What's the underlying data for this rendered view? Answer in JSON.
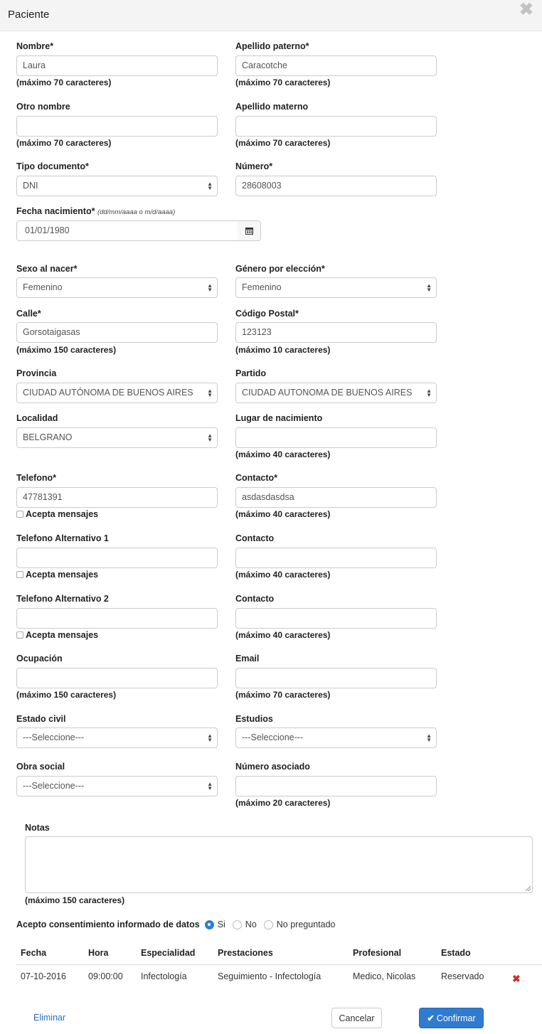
{
  "modal": {
    "title": "Paciente",
    "close_glyph": "✖"
  },
  "labels": {
    "nombre": "Nombre*",
    "apellido_paterno": "Apellido paterno*",
    "otro_nombre": "Otro nombre",
    "apellido_materno": "Apellido materno",
    "tipo_documento": "Tipo documento*",
    "numero": "Número*",
    "fecha_nacimiento": "Fecha nacimiento*",
    "fecha_formato": "(dd/mm/aaaa o m/d/aaaa)",
    "sexo": "Sexo al nacer*",
    "genero": "Género por elección*",
    "calle": "Calle*",
    "codigo_postal": "Código Postal*",
    "provincia": "Provincia",
    "partido": "Partido",
    "localidad": "Localidad",
    "lugar_nacimiento": "Lugar de nacimiento",
    "telefono": "Telefono*",
    "contacto_req": "Contacto*",
    "telefono_alt1": "Telefono Alternativo 1",
    "contacto": "Contacto",
    "telefono_alt2": "Telefono Alternativo 2",
    "ocupacion": "Ocupación",
    "email": "Email",
    "estado_civil": "Estado civil",
    "estudios": "Estudios",
    "obra_social": "Obra social",
    "numero_asociado": "Número asociado",
    "notas": "Notas"
  },
  "hints": {
    "max70": "(máximo 70 caracteres)",
    "max150": "(máximo 150 caracteres)",
    "max10": "(máximo 10 caracteres)",
    "max40": "(máximo 40 caracteres)",
    "max20": "(máximo 20 caracteres)"
  },
  "values": {
    "nombre": "Laura",
    "apellido_paterno": "Caracotche",
    "otro_nombre": "",
    "apellido_materno": "",
    "tipo_documento": "DNI",
    "numero": "28608003",
    "fecha_nacimiento": "01/01/1980",
    "sexo": "Femenino",
    "genero": "Femenino",
    "calle": "Gorsotaigasas",
    "codigo_postal": "123123",
    "provincia": "CIUDAD AUTÓNOMA DE BUENOS AIRES",
    "partido": "CIUDAD AUTONOMA DE BUENOS AIRES",
    "localidad": "BELGRANO",
    "lugar_nacimiento": "",
    "telefono": "47781391",
    "contacto": "asdasdasdsa",
    "telefono_alt1": "",
    "contacto_alt1": "",
    "telefono_alt2": "",
    "contacto_alt2": "",
    "ocupacion": "",
    "email": "",
    "estado_civil": "---Seleccione---",
    "estudios": "---Seleccione---",
    "obra_social": "---Seleccione---",
    "numero_asociado": ""
  },
  "checkbox_label": "Acepta mensajes",
  "consent": {
    "question": "Acepto consentimiento informado de datos",
    "options": [
      "Si",
      "No",
      "No preguntado"
    ],
    "selected": "Si"
  },
  "table": {
    "headers": [
      "Fecha",
      "Hora",
      "Especialidad",
      "Prestaciones",
      "Profesional",
      "Estado"
    ],
    "rows": [
      [
        "07-10-2016",
        "09:00:00",
        "Infectología",
        "Seguimiento - Infectología",
        "Medico, Nicolas",
        "Reservado"
      ]
    ]
  },
  "actions": {
    "eliminar": "Eliminar",
    "cancelar": "Cancelar",
    "confirmar": "Confirmar"
  },
  "icons": {
    "close": "close-icon",
    "calendar": "calendar-icon",
    "delete_row": "delete-icon",
    "confirm": "check-icon",
    "select_arrows": "sort-arrows-icon"
  },
  "colors": {
    "primary": "#2f7bcf",
    "danger": "#c9302c",
    "link": "#2a6fc0"
  }
}
